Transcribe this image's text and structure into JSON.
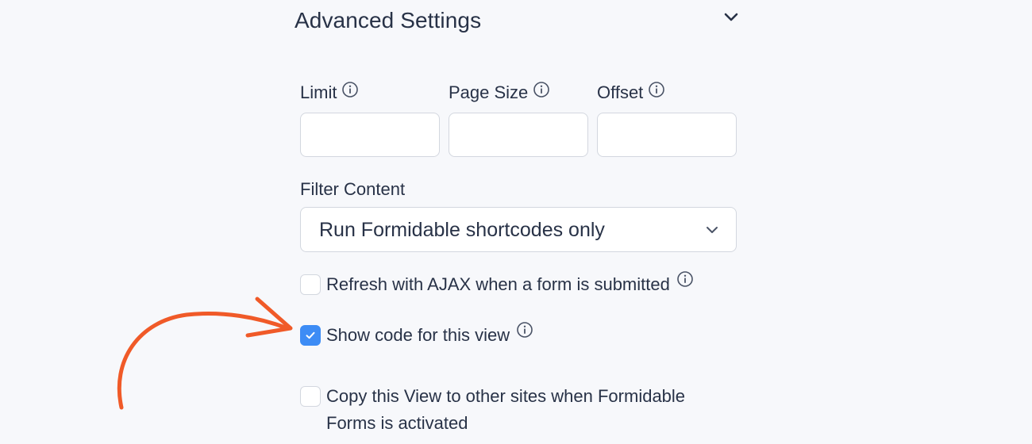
{
  "section": {
    "title": "Advanced Settings",
    "toggle_icon": "chevron-down-icon"
  },
  "fields": {
    "limit": {
      "label": "Limit",
      "value": "",
      "info_icon": "info-icon"
    },
    "page_size": {
      "label": "Page Size",
      "value": "",
      "info_icon": "info-icon"
    },
    "offset": {
      "label": "Offset",
      "value": "",
      "info_icon": "info-icon"
    }
  },
  "filter": {
    "label": "Filter Content",
    "selected": "Run Formidable shortcodes only"
  },
  "options": {
    "refresh_ajax": {
      "label": "Refresh with AJAX when a form is submitted",
      "checked": false
    },
    "show_code": {
      "label": "Show code for this view",
      "checked": true
    },
    "copy_view": {
      "label": "Copy this View to other sites when Formidable Forms is activated",
      "checked": false
    }
  },
  "colors": {
    "accent": "#3d8cf5",
    "annotation_arrow": "#f05a28",
    "text": "#283247",
    "background": "#f7f8fb"
  }
}
